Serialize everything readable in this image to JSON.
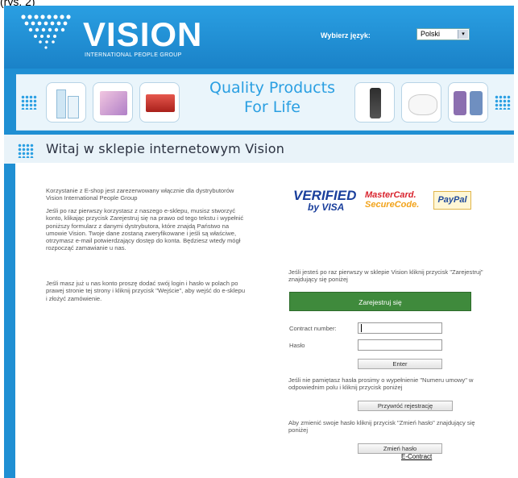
{
  "caption": "(rys. 2)",
  "header": {
    "logo_text": "VISION",
    "logo_subtitle": "INTERNATIONAL PEOPLE GROUP",
    "language_label": "Wybierz język:",
    "language_value": "Polski",
    "dropdown_arrow": "▾"
  },
  "banner": {
    "tagline_line1": "Quality Products",
    "tagline_line2": "For Life"
  },
  "page_title": "Witaj w sklepie internetowym Vision",
  "left_text": {
    "p1": "Korzystanie z E-shop jest zarezerwowany włącznie dla dystrybutorów Vision International People Group",
    "p2": "Jeśli po raz pierwszy korzystasz z naszego e-sklepu, musisz stworzyć konto, klikając przycisk Zarejestruj się na prawo od tego tekstu i wypełnić poniższy formularz z danymi dystrybutora, które znajdą Państwo na umowie Vision. Twoje dane zostaną zweryfikowane i jeśli są właściwe, otrzymasz e-mail potwierdzający dostęp do konta. Będziesz wtedy mógł rozpocząć zamawianie u nas.",
    "p3": "Jeśli masz już u nas konto proszę dodać swój login i hasło w polach po prawej stronie tej strony i kliknij przycisk \"Wejście\", aby wejść do e-sklepu i złożyć zamówienie."
  },
  "badges": {
    "verified_line1": "VERIFIED",
    "verified_line2": "by VISA",
    "mastercard_line1": "MasterCard.",
    "mastercard_line2": "SecureCode.",
    "paypal": "PayPal"
  },
  "right": {
    "register_info": "Jeśli jesteś po raz pierwszy w sklepie Vision kliknij przycisk \"Zarejestruj\" znajdujący się poniżej",
    "register_button": "Zarejestruj się",
    "contract_label": "Contract number:",
    "password_label": "Hasło",
    "enter_button": "Enter",
    "forgot_info": "Jeśli nie pamiętasz hasła prosimy o wypełnienie \"Numeru umowy\" w odpowiednim polu i kliknij przycisk poniżej",
    "restore_button": "Przywróć rejestrację",
    "change_info": "Aby zmienić swoje hasło kliknij przycisk \"Zmień hasło\" znajdujący się poniżej",
    "change_button": "Zmień hasło",
    "econtract_link": "E-Contract"
  },
  "colors": {
    "header_blue": "#1f8fd3",
    "register_green": "#3f8a3c",
    "tagline_blue": "#2a9fe2"
  }
}
